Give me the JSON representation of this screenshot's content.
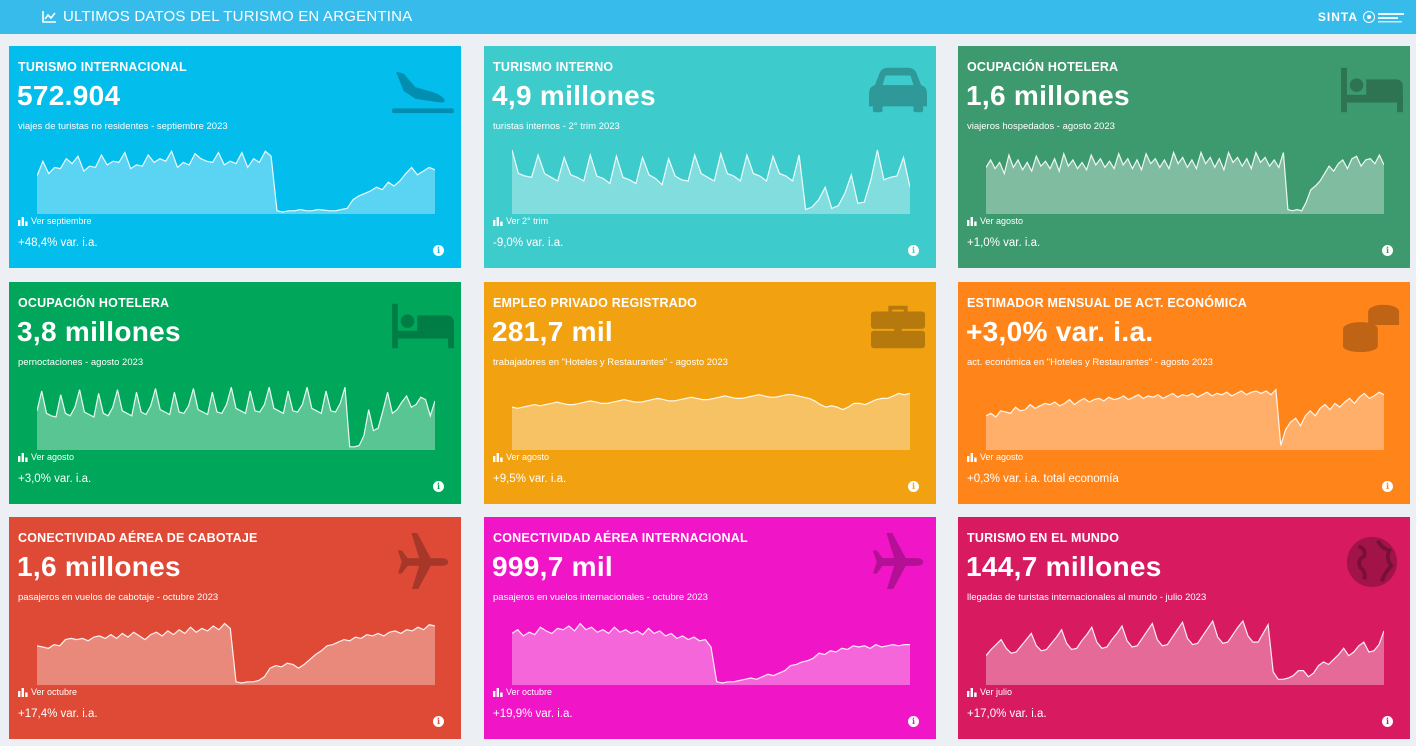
{
  "header": {
    "title": "ULTIMOS DATOS DEL TURISMO EN ARGENTINA",
    "brand": "SINTA",
    "bg": "#37bbea"
  },
  "cards": [
    {
      "title": "TURISMO INTERNACIONAL",
      "value": "572.904",
      "subtitle": "viajes de turistas no residentes - septiembre 2023",
      "link": "Ver septiembre",
      "variation": "+48,4% var. i.a.",
      "color": "#03bdec",
      "icon": "plane-arrival-icon",
      "series": [
        0.58,
        0.82,
        0.62,
        0.72,
        0.7,
        0.86,
        0.78,
        0.9,
        0.66,
        0.74,
        0.72,
        0.92,
        0.76,
        0.82,
        0.8,
        0.96,
        0.7,
        0.76,
        0.74,
        0.92,
        0.8,
        0.86,
        0.82,
        0.98,
        0.72,
        0.8,
        0.76,
        0.94,
        0.86,
        0.82,
        0.8,
        0.96,
        0.76,
        0.82,
        0.78,
        0.96,
        0.72,
        0.86,
        0.8,
        0.98,
        0.9,
        0.02,
        0.0,
        0.02,
        0.02,
        0.04,
        0.02,
        0.02,
        0.04,
        0.03,
        0.02,
        0.02,
        0.04,
        0.06,
        0.2,
        0.26,
        0.3,
        0.34,
        0.4,
        0.36,
        0.48,
        0.42,
        0.5,
        0.62,
        0.72,
        0.6,
        0.66,
        0.72,
        0.68
      ]
    },
    {
      "title": "TURISMO INTERNO",
      "value": "4,9 millones",
      "subtitle": "turistas internos - 2° trim 2023",
      "link": "Ver 2° trim",
      "variation": "-9,0% var. i.a.",
      "color": "#3ecbcc",
      "icon": "car-icon",
      "series": [
        1.0,
        0.62,
        0.58,
        0.56,
        0.92,
        0.62,
        0.56,
        0.5,
        0.88,
        0.6,
        0.56,
        0.5,
        0.92,
        0.58,
        0.54,
        0.46,
        0.9,
        0.56,
        0.52,
        0.46,
        0.88,
        0.6,
        0.54,
        0.44,
        0.86,
        0.58,
        0.52,
        0.5,
        0.92,
        0.62,
        0.56,
        0.5,
        0.94,
        0.62,
        0.58,
        0.5,
        0.92,
        0.62,
        0.58,
        0.5,
        0.9,
        0.62,
        0.58,
        0.5,
        0.92,
        0.04,
        0.08,
        0.2,
        0.4,
        0.06,
        0.1,
        0.3,
        0.6,
        0.14,
        0.16,
        0.52,
        1.0,
        0.52,
        0.56,
        0.58,
        0.88,
        0.4
      ]
    },
    {
      "title": "OCUPACIÓN HOTELERA",
      "value": "1,6 millones",
      "subtitle": "viajeros hospedados - agosto 2023",
      "link": "Ver agosto",
      "variation": "+1,0% var. i.a.",
      "color": "#3d9a6e",
      "icon": "bed-icon",
      "series": [
        0.72,
        0.84,
        0.7,
        0.8,
        0.62,
        0.92,
        0.72,
        0.84,
        0.68,
        0.8,
        0.66,
        0.9,
        0.74,
        0.82,
        0.7,
        0.86,
        0.66,
        0.94,
        0.74,
        0.84,
        0.7,
        0.8,
        0.68,
        0.92,
        0.76,
        0.86,
        0.72,
        0.82,
        0.7,
        0.94,
        0.76,
        0.86,
        0.7,
        0.84,
        0.68,
        0.94,
        0.78,
        0.86,
        0.72,
        0.84,
        0.7,
        0.96,
        0.78,
        0.88,
        0.72,
        0.84,
        0.7,
        0.96,
        0.78,
        0.88,
        0.72,
        0.86,
        0.68,
        0.96,
        0.8,
        0.88,
        0.74,
        0.86,
        0.7,
        0.96,
        0.8,
        0.88,
        0.74,
        0.84,
        0.72,
        0.96,
        0.04,
        0.02,
        0.04,
        0.02,
        0.16,
        0.36,
        0.42,
        0.5,
        0.62,
        0.74,
        0.66,
        0.78,
        0.84,
        0.7,
        0.86,
        0.9,
        0.74,
        0.84,
        0.86,
        0.78,
        0.92,
        0.76
      ]
    },
    {
      "title": "OCUPACIÓN HOTELERA",
      "value": "3,8 millones",
      "subtitle": "pernoctaciones - agosto 2023",
      "link": "Ver agosto",
      "variation": "+3,0% var. i.a.",
      "color": "#00a65a",
      "icon": "bed-icon",
      "series": [
        0.6,
        0.92,
        0.56,
        0.52,
        0.5,
        0.86,
        0.56,
        0.52,
        0.66,
        0.94,
        0.58,
        0.54,
        0.5,
        0.88,
        0.56,
        0.52,
        0.66,
        0.94,
        0.6,
        0.56,
        0.52,
        0.9,
        0.58,
        0.54,
        0.68,
        0.96,
        0.62,
        0.58,
        0.54,
        0.9,
        0.58,
        0.56,
        0.68,
        0.96,
        0.62,
        0.58,
        0.54,
        0.9,
        0.58,
        0.56,
        0.7,
        0.98,
        0.64,
        0.6,
        0.56,
        0.92,
        0.6,
        0.58,
        0.7,
        0.98,
        0.64,
        0.6,
        0.56,
        0.92,
        0.6,
        0.58,
        0.7,
        0.98,
        0.64,
        0.6,
        0.56,
        0.92,
        0.6,
        0.58,
        0.72,
        0.98,
        0.02,
        0.02,
        0.04,
        0.2,
        0.62,
        0.28,
        0.32,
        0.6,
        0.9,
        0.56,
        0.62,
        0.74,
        0.84,
        0.66,
        0.7,
        0.82,
        0.78,
        0.52,
        0.76
      ]
    },
    {
      "title": "EMPLEO PRIVADO REGISTRADO",
      "value": "281,7 mil",
      "subtitle": "trabajadores en \"Hoteles y Restaurantes\" - agosto 2023",
      "link": "Ver agosto",
      "variation": "+9,5% var. i.a.",
      "color": "#f2a111",
      "icon": "briefcase-icon",
      "series": [
        0.66,
        0.64,
        0.66,
        0.68,
        0.7,
        0.68,
        0.7,
        0.72,
        0.74,
        0.72,
        0.7,
        0.7,
        0.72,
        0.74,
        0.76,
        0.74,
        0.72,
        0.72,
        0.74,
        0.76,
        0.78,
        0.76,
        0.74,
        0.74,
        0.76,
        0.78,
        0.8,
        0.78,
        0.76,
        0.76,
        0.78,
        0.8,
        0.82,
        0.8,
        0.78,
        0.78,
        0.8,
        0.82,
        0.84,
        0.82,
        0.8,
        0.8,
        0.82,
        0.84,
        0.86,
        0.84,
        0.82,
        0.82,
        0.84,
        0.86,
        0.86,
        0.84,
        0.82,
        0.8,
        0.76,
        0.7,
        0.66,
        0.68,
        0.66,
        0.62,
        0.66,
        0.72,
        0.72,
        0.7,
        0.74,
        0.78,
        0.8,
        0.8,
        0.84,
        0.88,
        0.86,
        0.88
      ]
    },
    {
      "title": "ESTIMADOR MENSUAL DE ACT. ECONÓMICA",
      "value": "+3,0% var. i.a.",
      "subtitle": "act. económica en \"Hoteles y Restaurantes\" - agosto 2023",
      "link": "Ver agosto",
      "variation": "+0,3% var. i.a. total economía",
      "color": "#ff851b",
      "icon": "coins-icon",
      "series": [
        0.52,
        0.56,
        0.5,
        0.6,
        0.58,
        0.56,
        0.66,
        0.6,
        0.62,
        0.7,
        0.64,
        0.68,
        0.72,
        0.7,
        0.74,
        0.68,
        0.72,
        0.78,
        0.7,
        0.76,
        0.8,
        0.74,
        0.78,
        0.8,
        0.76,
        0.82,
        0.78,
        0.8,
        0.84,
        0.78,
        0.82,
        0.86,
        0.8,
        0.84,
        0.82,
        0.86,
        0.8,
        0.84,
        0.88,
        0.82,
        0.86,
        0.84,
        0.88,
        0.82,
        0.86,
        0.9,
        0.84,
        0.88,
        0.86,
        0.9,
        0.84,
        0.88,
        0.92,
        0.86,
        0.9,
        0.92,
        0.88,
        0.92,
        0.86,
        0.94,
        0.04,
        0.3,
        0.42,
        0.48,
        0.36,
        0.52,
        0.6,
        0.52,
        0.64,
        0.7,
        0.62,
        0.72,
        0.66,
        0.74,
        0.8,
        0.72,
        0.82,
        0.88,
        0.8,
        0.84,
        0.9,
        0.86
      ]
    },
    {
      "title": "CONECTIVIDAD AÉREA DE CABOTAJE",
      "value": "1,6 millones",
      "subtitle": "pasajeros en vuelos de cabotaje - octubre 2023",
      "link": "Ver octubre",
      "variation": "+17,4% var. i.a.",
      "color": "#de4a36",
      "icon": "airplane-icon",
      "series": [
        0.6,
        0.58,
        0.56,
        0.62,
        0.6,
        0.7,
        0.72,
        0.7,
        0.72,
        0.68,
        0.74,
        0.76,
        0.72,
        0.78,
        0.72,
        0.8,
        0.74,
        0.82,
        0.76,
        0.7,
        0.78,
        0.82,
        0.76,
        0.84,
        0.78,
        0.86,
        0.8,
        0.9,
        0.82,
        0.88,
        0.84,
        0.92,
        0.86,
        0.96,
        0.88,
        0.02,
        0.0,
        0.02,
        0.02,
        0.04,
        0.1,
        0.24,
        0.28,
        0.26,
        0.32,
        0.3,
        0.24,
        0.3,
        0.38,
        0.46,
        0.52,
        0.6,
        0.62,
        0.66,
        0.7,
        0.68,
        0.74,
        0.72,
        0.78,
        0.76,
        0.8,
        0.76,
        0.82,
        0.84,
        0.8,
        0.86,
        0.84,
        0.9,
        0.86,
        0.94,
        0.92
      ]
    },
    {
      "title": "CONECTIVIDAD AÉREA INTERNACIONAL",
      "value": "999,7 mil",
      "subtitle": "pasajeros en vuelos internacionales - octubre 2023",
      "link": "Ver octubre",
      "variation": "+19,9% var. i.a.",
      "color": "#f015c6",
      "icon": "airplane-icon",
      "series": [
        0.8,
        0.86,
        0.76,
        0.82,
        0.78,
        0.9,
        0.84,
        0.8,
        0.88,
        0.86,
        0.92,
        0.84,
        0.96,
        0.86,
        0.9,
        0.82,
        0.86,
        0.8,
        0.9,
        0.82,
        0.86,
        0.8,
        0.84,
        0.78,
        0.88,
        0.8,
        0.84,
        0.76,
        0.8,
        0.72,
        0.76,
        0.7,
        0.74,
        0.68,
        0.7,
        0.58,
        0.02,
        0.0,
        0.02,
        0.02,
        0.04,
        0.06,
        0.08,
        0.06,
        0.1,
        0.14,
        0.12,
        0.16,
        0.2,
        0.28,
        0.3,
        0.34,
        0.36,
        0.4,
        0.48,
        0.46,
        0.52,
        0.5,
        0.56,
        0.54,
        0.6,
        0.58,
        0.6,
        0.56,
        0.62,
        0.58,
        0.6,
        0.62,
        0.6,
        0.62,
        0.62
      ]
    },
    {
      "title": "TURISMO EN EL MUNDO",
      "value": "144,7 millones",
      "subtitle": "llegadas de turistas internacionales al mundo - julio 2023",
      "link": "Ver julio",
      "variation": "+17,0% var. i.a.",
      "color": "#d81b60",
      "icon": "globe-icon",
      "series": [
        0.44,
        0.54,
        0.62,
        0.7,
        0.56,
        0.48,
        0.5,
        0.6,
        0.7,
        0.8,
        0.6,
        0.52,
        0.54,
        0.64,
        0.74,
        0.86,
        0.64,
        0.54,
        0.56,
        0.68,
        0.78,
        0.9,
        0.66,
        0.56,
        0.58,
        0.7,
        0.8,
        0.92,
        0.68,
        0.58,
        0.6,
        0.72,
        0.84,
        0.96,
        0.7,
        0.6,
        0.62,
        0.74,
        0.86,
        0.98,
        0.72,
        0.62,
        0.64,
        0.76,
        0.88,
        1.0,
        0.74,
        0.64,
        0.66,
        0.78,
        0.9,
        1.0,
        0.76,
        0.66,
        0.66,
        0.8,
        0.94,
        0.18,
        0.06,
        0.06,
        0.08,
        0.12,
        0.2,
        0.2,
        0.1,
        0.16,
        0.28,
        0.34,
        0.3,
        0.38,
        0.46,
        0.56,
        0.44,
        0.5,
        0.6,
        0.66,
        0.5,
        0.52,
        0.62,
        0.84
      ]
    }
  ]
}
